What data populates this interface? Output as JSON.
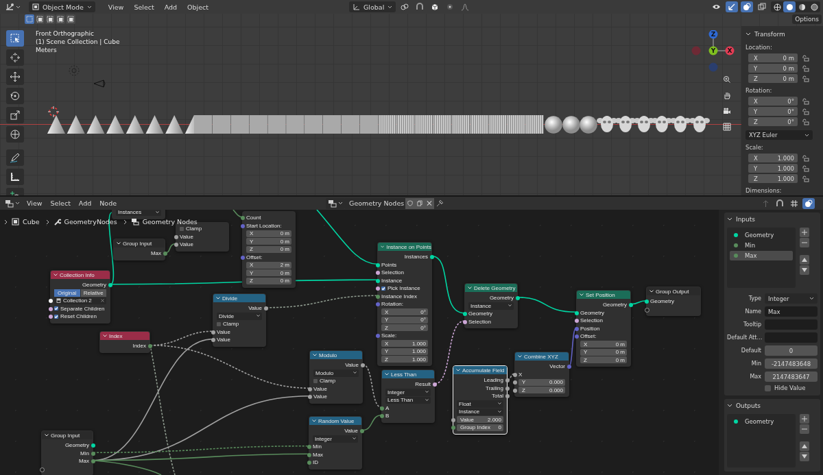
{
  "viewport_header": {
    "mode": "Object Mode",
    "menus": [
      "View",
      "Select",
      "Add",
      "Object"
    ],
    "orientation": "Global",
    "select_modes": [
      {
        "selected": true
      },
      {
        "selected": false
      },
      {
        "selected": false
      },
      {
        "selected": false
      },
      {
        "selected": false
      }
    ],
    "toggles": [
      {
        "kind": "gizmo",
        "on": true
      },
      {
        "kind": "overlay",
        "on": true
      },
      {
        "kind": "xray",
        "on": false
      }
    ],
    "shading_modes": [
      {
        "kind": "wireframe",
        "selected": false
      },
      {
        "kind": "solid",
        "selected": true
      },
      {
        "kind": "material",
        "selected": false
      },
      {
        "kind": "rendered",
        "selected": false
      }
    ],
    "options": "Options"
  },
  "viewport": {
    "view_name": "Front Orthographic",
    "collection": "(1) Scene Collection | Cube",
    "units": "Meters",
    "tools": [
      {
        "kind": "select",
        "selected": true
      },
      {
        "kind": "cursor",
        "selected": false
      },
      {
        "kind": "move",
        "selected": false
      },
      {
        "kind": "rotate",
        "selected": false
      },
      {
        "kind": "scale",
        "selected": false
      },
      {
        "kind": "transform",
        "selected": false
      },
      {
        "kind": "annotate",
        "selected": false
      },
      {
        "kind": "measure",
        "selected": false
      },
      {
        "kind": "add",
        "selected": false
      }
    ],
    "gizmo": {
      "x": "X",
      "y": "Y",
      "z": "Z"
    }
  },
  "transform_panel": {
    "title": "Transform",
    "sections": [
      {
        "kind": "vector",
        "label": "Location:",
        "fields": [
          {
            "axis": "X",
            "value": "0 m"
          },
          {
            "axis": "Y",
            "value": "0 m"
          },
          {
            "axis": "Z",
            "value": "0 m"
          }
        ]
      },
      {
        "kind": "vector",
        "label": "Rotation:",
        "fields": [
          {
            "axis": "X",
            "value": "0°"
          },
          {
            "axis": "Y",
            "value": "0°"
          },
          {
            "axis": "Z",
            "value": "0°"
          }
        ]
      },
      {
        "kind": "dropdown",
        "value": "XYZ Euler"
      },
      {
        "kind": "vector",
        "label": "Scale:",
        "fields": [
          {
            "axis": "X",
            "value": "1.000"
          },
          {
            "axis": "Y",
            "value": "1.000"
          },
          {
            "axis": "Z",
            "value": "1.000"
          }
        ]
      },
      {
        "kind": "label",
        "label": "Dimensions:"
      }
    ]
  },
  "node_editor": {
    "menus": [
      "View",
      "Select",
      "Add",
      "Node"
    ],
    "node_group": "Geometry Nodes",
    "breadcrumbs": [
      "Cube",
      "GeometryNodes",
      "Geometry Nodes"
    ],
    "nodes": [
      {
        "selected": false,
        "rows": [
          {
            "kind": "dropdown",
            "value": "Instances"
          }
        ]
      },
      {
        "selected": false,
        "rows": [
          {
            "kind": "checkbox",
            "label": "Clamp",
            "checked": false
          },
          {
            "kind": "input",
            "label": "Value",
            "color": "#a1a1a1"
          },
          {
            "kind": "input",
            "label": "Value",
            "color": "#a1a1a1"
          }
        ]
      },
      {
        "title": "Group Input",
        "color": "#2a2a2a",
        "selected": false,
        "rows": [
          {
            "kind": "output",
            "label": "Max",
            "color": "#598c5c"
          }
        ]
      },
      {
        "selected": false,
        "rows": [
          {
            "kind": "input",
            "label": "Count",
            "color": "#598c5c"
          },
          {
            "kind": "label",
            "label": "Start Location:",
            "color": "#6363c7"
          },
          {
            "kind": "field",
            "label": "X",
            "value": "0 m"
          },
          {
            "kind": "field",
            "label": "Y",
            "value": "0 m"
          },
          {
            "kind": "field",
            "label": "Z",
            "value": "0 m"
          },
          {
            "kind": "label",
            "label": "Offset:",
            "color": "#6363c7"
          },
          {
            "kind": "field",
            "label": "X",
            "value": "2 m"
          },
          {
            "kind": "field",
            "label": "Y",
            "value": "0 m"
          },
          {
            "kind": "field",
            "label": "Z",
            "value": "0 m"
          }
        ]
      },
      {
        "title": "Collection Info",
        "color": "#9a2d48",
        "selected": false,
        "rows": [
          {
            "kind": "output",
            "label": "Geometry",
            "color": "#00d6a3"
          },
          {
            "kind": "toggle",
            "options": [
              {
                "label": "Original",
                "selected": true
              },
              {
                "label": "Relative",
                "selected": false
              }
            ]
          },
          {
            "kind": "collection",
            "value": "Collection 2",
            "color": "#f5f5f5"
          },
          {
            "kind": "checkbox",
            "label": "Separate Children",
            "checked": true,
            "color": "#cca6d6"
          },
          {
            "kind": "checkbox",
            "label": "Reset Children",
            "checked": true,
            "color": "#cca6d6"
          }
        ]
      },
      {
        "title": "Index",
        "color": "#9a2d48",
        "selected": false,
        "rows": [
          {
            "kind": "output",
            "label": "Index",
            "color": "#598c5c"
          }
        ]
      },
      {
        "title": "Divide",
        "color": "#246283",
        "selected": false,
        "rows": [
          {
            "kind": "output",
            "label": "Value",
            "color": "#a1a1a1"
          },
          {
            "kind": "dropdown",
            "value": "Divide"
          },
          {
            "kind": "checkbox",
            "label": "Clamp",
            "checked": false
          },
          {
            "kind": "input",
            "label": "Value",
            "color": "#a1a1a1"
          },
          {
            "kind": "input",
            "label": "Value",
            "color": "#a1a1a1"
          }
        ]
      },
      {
        "title": "Group Input",
        "color": "#2a2a2a",
        "selected": false,
        "rows": [
          {
            "kind": "output",
            "label": "Geometry",
            "color": "#00d6a3"
          },
          {
            "kind": "output",
            "label": "Min",
            "color": "#598c5c"
          },
          {
            "kind": "output",
            "label": "Max",
            "color": "#598c5c"
          },
          {
            "kind": "empty"
          }
        ]
      },
      {
        "title": "Instance on Points",
        "color": "#1b6d58",
        "selected": false,
        "rows": [
          {
            "kind": "output",
            "label": "Instances",
            "color": "#00d6a3"
          },
          {
            "kind": "input",
            "label": "Points",
            "color": "#00d6a3"
          },
          {
            "kind": "input",
            "label": "Selection",
            "color": "#cca6d6"
          },
          {
            "kind": "input",
            "label": "Instance",
            "color": "#00d6a3"
          },
          {
            "kind": "checkbox",
            "label": "Pick Instance",
            "checked": true,
            "color": "#cca6d6"
          },
          {
            "kind": "input",
            "label": "Instance Index",
            "color": "#598c5c"
          },
          {
            "kind": "label",
            "label": "Rotation:",
            "color": "#6363c7"
          },
          {
            "kind": "field",
            "label": "X",
            "value": "0°"
          },
          {
            "kind": "field",
            "label": "Y",
            "value": "0°"
          },
          {
            "kind": "field",
            "label": "Z",
            "value": "0°"
          },
          {
            "kind": "label",
            "label": "Scale:",
            "color": "#6363c7"
          },
          {
            "kind": "field",
            "label": "X",
            "value": "1.000"
          },
          {
            "kind": "field",
            "label": "Y",
            "value": "1.000"
          },
          {
            "kind": "field",
            "label": "Z",
            "value": "1.000"
          }
        ]
      },
      {
        "title": "Delete Geometry",
        "color": "#1b6d58",
        "selected": false,
        "rows": [
          {
            "kind": "output",
            "label": "Geometry",
            "color": "#00d6a3"
          },
          {
            "kind": "dropdown",
            "value": "Instance"
          },
          {
            "kind": "input",
            "label": "Geometry",
            "color": "#00d6a3"
          },
          {
            "kind": "input",
            "label": "Selection",
            "color": "#cca6d6"
          }
        ]
      },
      {
        "title": "Set Position",
        "color": "#1b6d58",
        "selected": false,
        "rows": [
          {
            "kind": "output",
            "label": "Geometry",
            "color": "#00d6a3"
          },
          {
            "kind": "input",
            "label": "Geometry",
            "color": "#00d6a3"
          },
          {
            "kind": "input",
            "label": "Selection",
            "color": "#cca6d6"
          },
          {
            "kind": "input",
            "label": "Position",
            "color": "#6363c7"
          },
          {
            "kind": "label",
            "label": "Offset:",
            "color": "#6363c7"
          },
          {
            "kind": "field",
            "label": "X",
            "value": "0 m"
          },
          {
            "kind": "field",
            "label": "Y",
            "value": "0 m"
          },
          {
            "kind": "field",
            "label": "Z",
            "value": "0 m"
          }
        ]
      },
      {
        "title": "Group Output",
        "color": "#2a2a2a",
        "selected": false,
        "rows": [
          {
            "kind": "input",
            "label": "Geometry",
            "color": "#00d6a3"
          },
          {
            "kind": "empty"
          }
        ]
      },
      {
        "title": "Modulo",
        "color": "#246283",
        "selected": false,
        "rows": [
          {
            "kind": "output",
            "label": "Value",
            "color": "#a1a1a1"
          },
          {
            "kind": "dropdown",
            "value": "Modulo"
          },
          {
            "kind": "checkbox",
            "label": "Clamp",
            "checked": false
          },
          {
            "kind": "input",
            "label": "Value",
            "color": "#a1a1a1"
          },
          {
            "kind": "input",
            "label": "Value",
            "color": "#a1a1a1"
          }
        ]
      },
      {
        "title": "Less Than",
        "color": "#246283",
        "selected": false,
        "rows": [
          {
            "kind": "output",
            "label": "Result",
            "color": "#cca6d6"
          },
          {
            "kind": "dropdown",
            "value": "Integer"
          },
          {
            "kind": "dropdown",
            "value": "Less Than"
          },
          {
            "kind": "input",
            "label": "A",
            "color": "#598c5c"
          },
          {
            "kind": "input",
            "label": "B",
            "color": "#598c5c"
          }
        ]
      },
      {
        "title": "Accumulate Field",
        "color": "#246283",
        "selected": true,
        "rows": [
          {
            "kind": "output",
            "label": "Leading",
            "color": "#a1a1a1"
          },
          {
            "kind": "output",
            "label": "Trailing",
            "color": "#a1a1a1"
          },
          {
            "kind": "output",
            "label": "Total",
            "color": "#a1a1a1"
          },
          {
            "kind": "dropdown",
            "value": "Float"
          },
          {
            "kind": "dropdown",
            "value": "Instance"
          },
          {
            "kind": "field",
            "label": "Value",
            "value": "2.000",
            "color": "#a1a1a1"
          },
          {
            "kind": "field",
            "label": "Group Index",
            "value": "0",
            "color": "#598c5c"
          }
        ]
      },
      {
        "title": "Combine XYZ",
        "color": "#246283",
        "selected": false,
        "rows": [
          {
            "kind": "output",
            "label": "Vector",
            "color": "#6363c7"
          },
          {
            "kind": "input",
            "label": "X",
            "color": "#a1a1a1"
          },
          {
            "kind": "field",
            "label": "Y",
            "value": "0.000",
            "color": "#a1a1a1"
          },
          {
            "kind": "field",
            "label": "Z",
            "value": "0.000",
            "color": "#a1a1a1"
          }
        ]
      },
      {
        "title": "Random Value",
        "color": "#246283",
        "selected": false,
        "rows": [
          {
            "kind": "output",
            "label": "Value",
            "color": "#598c5c"
          },
          {
            "kind": "dropdown",
            "value": "Integer"
          },
          {
            "kind": "input",
            "label": "Min",
            "color": "#598c5c"
          },
          {
            "kind": "input",
            "label": "Max",
            "color": "#598c5c"
          },
          {
            "kind": "input",
            "label": "ID",
            "color": "#598c5c"
          }
        ]
      }
    ]
  },
  "group_sidebar": {
    "inputs_title": "Inputs",
    "inputs": [
      {
        "name": "Geometry",
        "color": "#00d6a3",
        "selected": false
      },
      {
        "name": "Min",
        "color": "#598c5c",
        "selected": false
      },
      {
        "name": "Max",
        "color": "#598c5c",
        "selected": true
      }
    ],
    "properties": [
      {
        "kind": "dropdown",
        "label": "Type",
        "value": "Integer"
      },
      {
        "kind": "text",
        "label": "Name",
        "value": "Max"
      },
      {
        "kind": "text",
        "label": "Tooltip"
      },
      {
        "kind": "text",
        "label": "Default Att…"
      },
      {
        "kind": "number",
        "label": "Default",
        "value": "0"
      },
      {
        "kind": "number",
        "label": "Min",
        "value": "-2147483648"
      },
      {
        "kind": "number",
        "label": "Max",
        "value": "2147483647"
      }
    ],
    "hide_value": {
      "label": "Hide Value",
      "checked": false
    },
    "outputs_title": "Outputs",
    "outputs": [
      {
        "name": "Geometry",
        "color": "#00d6a3",
        "selected": false
      }
    ]
  }
}
